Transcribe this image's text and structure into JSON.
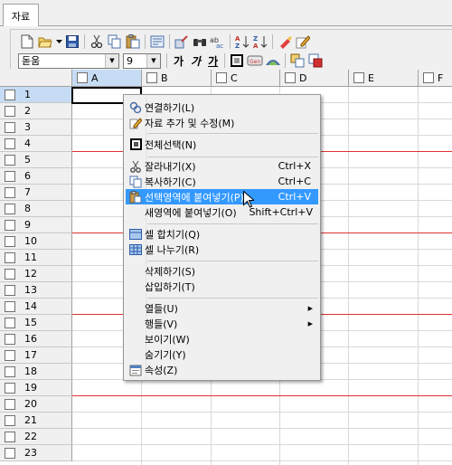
{
  "tabs": [
    "자료"
  ],
  "toolbar": {
    "row1_icons": [
      "new-file-icon",
      "open-folder-icon",
      "dropdown-arrow-icon",
      "save-icon",
      "cut-icon",
      "copy-icon",
      "paste-icon",
      "print-preview-icon",
      "tools-icon",
      "find-icon",
      "replace-icon",
      "sort-ascending-icon",
      "sort-descending-icon",
      "clear-icon",
      "edit-icon"
    ],
    "font_name": "돋움",
    "font_size": "9",
    "bold_label": "가",
    "italic_label": "가",
    "underline_label": "가",
    "row2_icons": [
      "cell-border-icon",
      "cell-format-icon",
      "cell-color-icon",
      "merge-icon",
      "properties-icon"
    ]
  },
  "grid": {
    "columns": [
      "A",
      "B",
      "C",
      "D",
      "E",
      "F"
    ],
    "rows": [
      "1",
      "2",
      "3",
      "4",
      "5",
      "6",
      "7",
      "8",
      "9",
      "10",
      "11",
      "12",
      "13",
      "14",
      "15",
      "16",
      "17",
      "18",
      "19",
      "20",
      "21",
      "22",
      "23"
    ],
    "red_rows_after": [
      "4",
      "9",
      "14",
      "19"
    ]
  },
  "context_menu": {
    "items": [
      {
        "label": "연결하기(L)",
        "shortcut": "",
        "icon": "link-icon",
        "highlighted": false,
        "submenu": false
      },
      {
        "label": "자료 추가 및 수정(M)",
        "shortcut": "",
        "icon": "edit-pencil-icon",
        "highlighted": false,
        "submenu": false
      },
      {
        "label": "전체선택(N)",
        "shortcut": "",
        "icon": "select-all-icon",
        "highlighted": false,
        "submenu": false
      },
      {
        "label": "잘라내기(X)",
        "shortcut": "Ctrl+X",
        "icon": "cut-icon",
        "highlighted": false,
        "submenu": false
      },
      {
        "label": "복사하기(C)",
        "shortcut": "Ctrl+C",
        "icon": "copy-icon",
        "highlighted": false,
        "submenu": false
      },
      {
        "label": "선택영역에 붙여넣기(P)",
        "shortcut": "Ctrl+V",
        "icon": "paste-icon",
        "highlighted": true,
        "submenu": false
      },
      {
        "label": "새영역에 붙여넣기(O)",
        "shortcut": "Shift+Ctrl+V",
        "icon": "",
        "highlighted": false,
        "submenu": false
      },
      {
        "label": "셀 합치기(Q)",
        "shortcut": "",
        "icon": "merge-cells-icon",
        "highlighted": false,
        "submenu": false
      },
      {
        "label": "셀 나누기(R)",
        "shortcut": "",
        "icon": "split-cells-icon",
        "highlighted": false,
        "submenu": false
      },
      {
        "label": "삭제하기(S)",
        "shortcut": "",
        "icon": "",
        "highlighted": false,
        "submenu": false
      },
      {
        "label": "삽입하기(T)",
        "shortcut": "",
        "icon": "",
        "highlighted": false,
        "submenu": false
      },
      {
        "label": "열들(U)",
        "shortcut": "",
        "icon": "",
        "highlighted": false,
        "submenu": true
      },
      {
        "label": "행들(V)",
        "shortcut": "",
        "icon": "",
        "highlighted": false,
        "submenu": true
      },
      {
        "label": "보이기(W)",
        "shortcut": "",
        "icon": "",
        "highlighted": false,
        "submenu": false
      },
      {
        "label": "숨기기(Y)",
        "shortcut": "",
        "icon": "",
        "highlighted": false,
        "submenu": false
      },
      {
        "label": "속성(Z)",
        "shortcut": "",
        "icon": "properties-icon",
        "highlighted": false,
        "submenu": false
      }
    ]
  },
  "colors": {
    "highlight": "#3399ff",
    "header_active": "#c6dcf4",
    "separator_red": "#e03030"
  }
}
